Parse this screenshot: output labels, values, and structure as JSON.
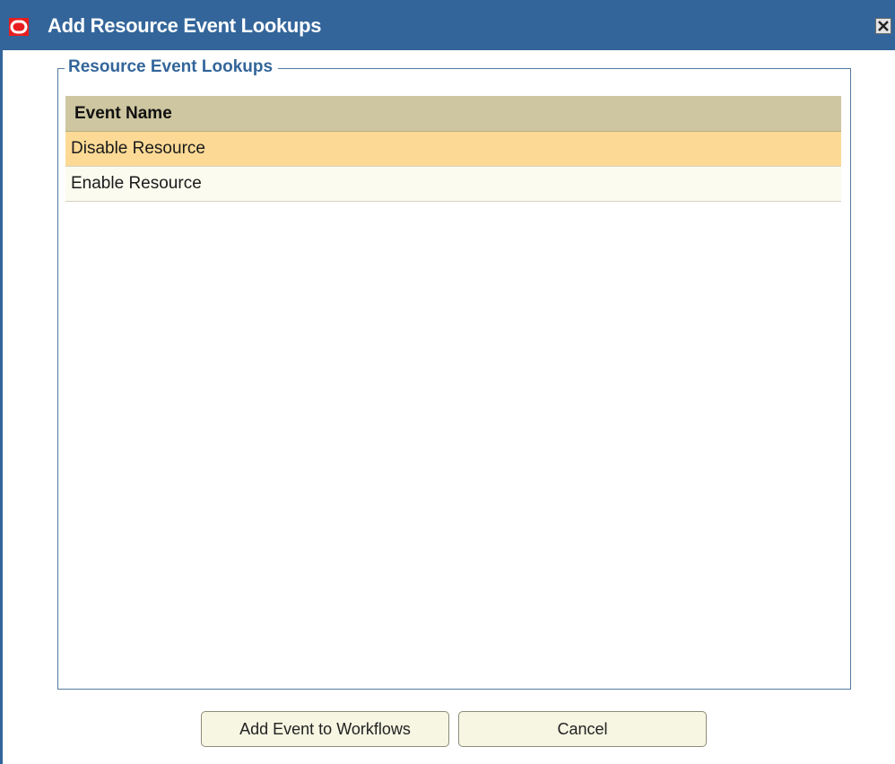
{
  "window": {
    "title": "Add Resource Event Lookups",
    "colors": {
      "titlebar": "#33659a",
      "header": "#cec6a0",
      "selected_row": "#fcda96",
      "row": "#fbfbef",
      "logo": "#e81e1e"
    },
    "icons": {
      "logo": "oracle-logo-icon",
      "close": "close-icon"
    }
  },
  "group": {
    "legend": "Resource Event Lookups"
  },
  "table": {
    "columns": [
      "Event Name"
    ],
    "rows": [
      {
        "event_name": "Disable Resource",
        "selected": true
      },
      {
        "event_name": "Enable Resource",
        "selected": false
      }
    ]
  },
  "buttons": {
    "add_label": "Add Event to Workflows",
    "cancel_label": "Cancel"
  }
}
